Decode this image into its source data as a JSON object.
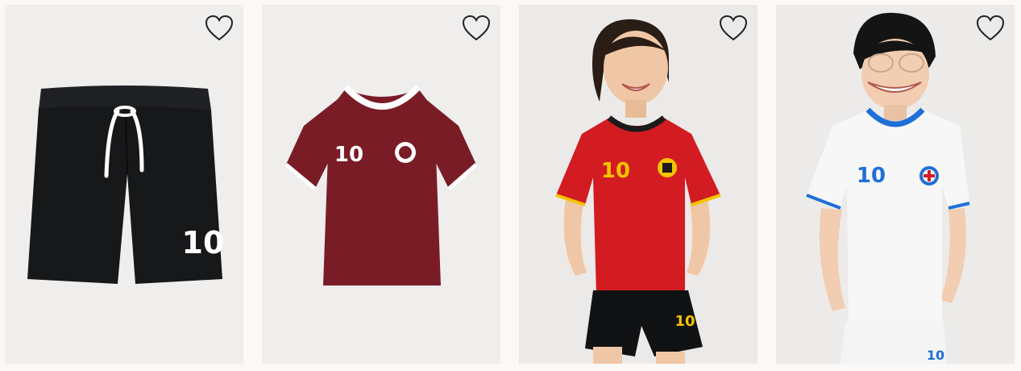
{
  "products": [
    {
      "id": "p1",
      "kind": "shorts",
      "colors": {
        "bg": "#efeeec",
        "garment": "#17181a",
        "trim": "#ffffff"
      },
      "number": "10",
      "favorite_icon": "heart-outline-icon"
    },
    {
      "id": "p2",
      "kind": "shirt",
      "colors": {
        "bg": "#efeeec",
        "garment": "#7a1c26",
        "trim": "#ffffff"
      },
      "number": "10",
      "favorite_icon": "heart-outline-icon"
    },
    {
      "id": "p3",
      "kind": "model-kit",
      "colors": {
        "bg": "#eceae8",
        "garment": "#d21c22",
        "trim": "#f5c400",
        "shorts": "#111214"
      },
      "number": "10",
      "favorite_icon": "heart-outline-icon"
    },
    {
      "id": "p4",
      "kind": "model-kit",
      "colors": {
        "bg": "#ecebea",
        "garment": "#f7f7f8",
        "trim": "#1f6fd8",
        "shorts": "#f4f4f5"
      },
      "number": "10",
      "favorite_icon": "heart-outline-icon"
    }
  ]
}
